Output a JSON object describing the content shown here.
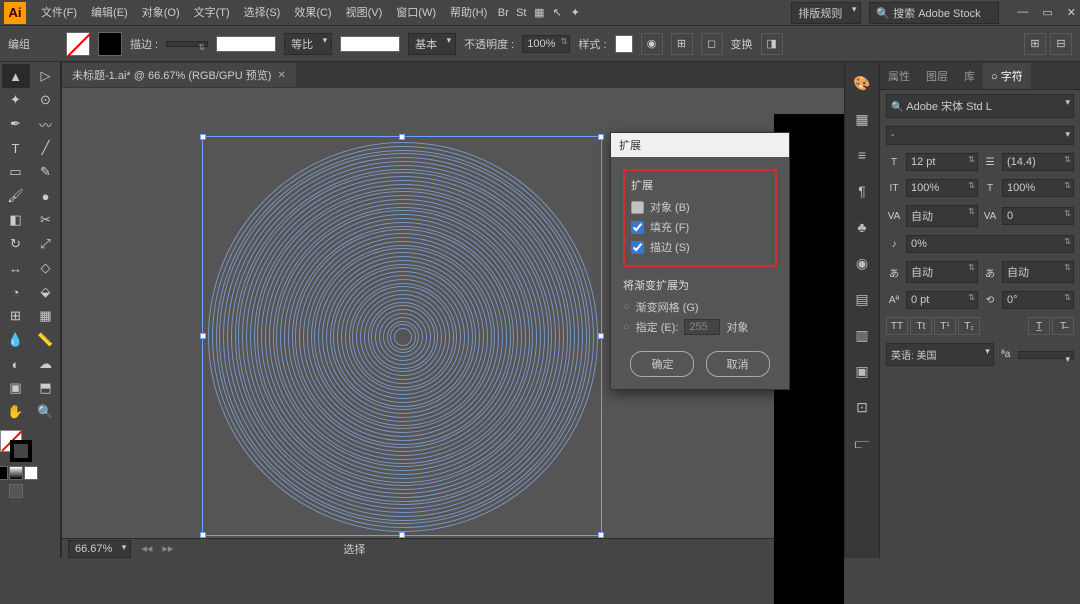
{
  "menubar": {
    "items": [
      "文件(F)",
      "编辑(E)",
      "对象(O)",
      "文字(T)",
      "选择(S)",
      "效果(C)",
      "视图(V)",
      "窗口(W)",
      "帮助(H)"
    ],
    "layout_rule": "排版规则",
    "search_placeholder": "搜索 Adobe Stock"
  },
  "optbar": {
    "mode": "编组",
    "stroke_label": "描边 :",
    "stroke_weight": "",
    "uniform": "等比",
    "basic": "基本",
    "opacity_label": "不透明度 :",
    "opacity": "100%",
    "style_label": "样式 :",
    "transform": "变换"
  },
  "doc": {
    "tab": "未标题-1.ai* @ 66.67% (RGB/GPU 预览)",
    "zoom": "66.67%",
    "status": "选择"
  },
  "char": {
    "tabs": [
      "属性",
      "图层",
      "库",
      "○ 字符"
    ],
    "font": "Adobe 宋体 Std L",
    "style": "-",
    "size": "12 pt",
    "leading": "(14.4)",
    "vscale": "100%",
    "hscale": "100%",
    "kerning": "自动",
    "tracking": "0",
    "baseline_opt": "0%",
    "auto": "自动",
    "baseline_shift": "0 pt",
    "rotation": "0°",
    "lang": "英语: 美国"
  },
  "dialog": {
    "title": "扩展",
    "section1": "扩展",
    "object": "对象 (B)",
    "fill": "填充 (F)",
    "stroke": "描边 (S)",
    "section2": "将渐变扩展为",
    "grad_mesh": "渐变网格 (G)",
    "specify": "指定 (E):",
    "specify_val": "255",
    "specify_unit": "对象",
    "ok": "确定",
    "cancel": "取消"
  }
}
